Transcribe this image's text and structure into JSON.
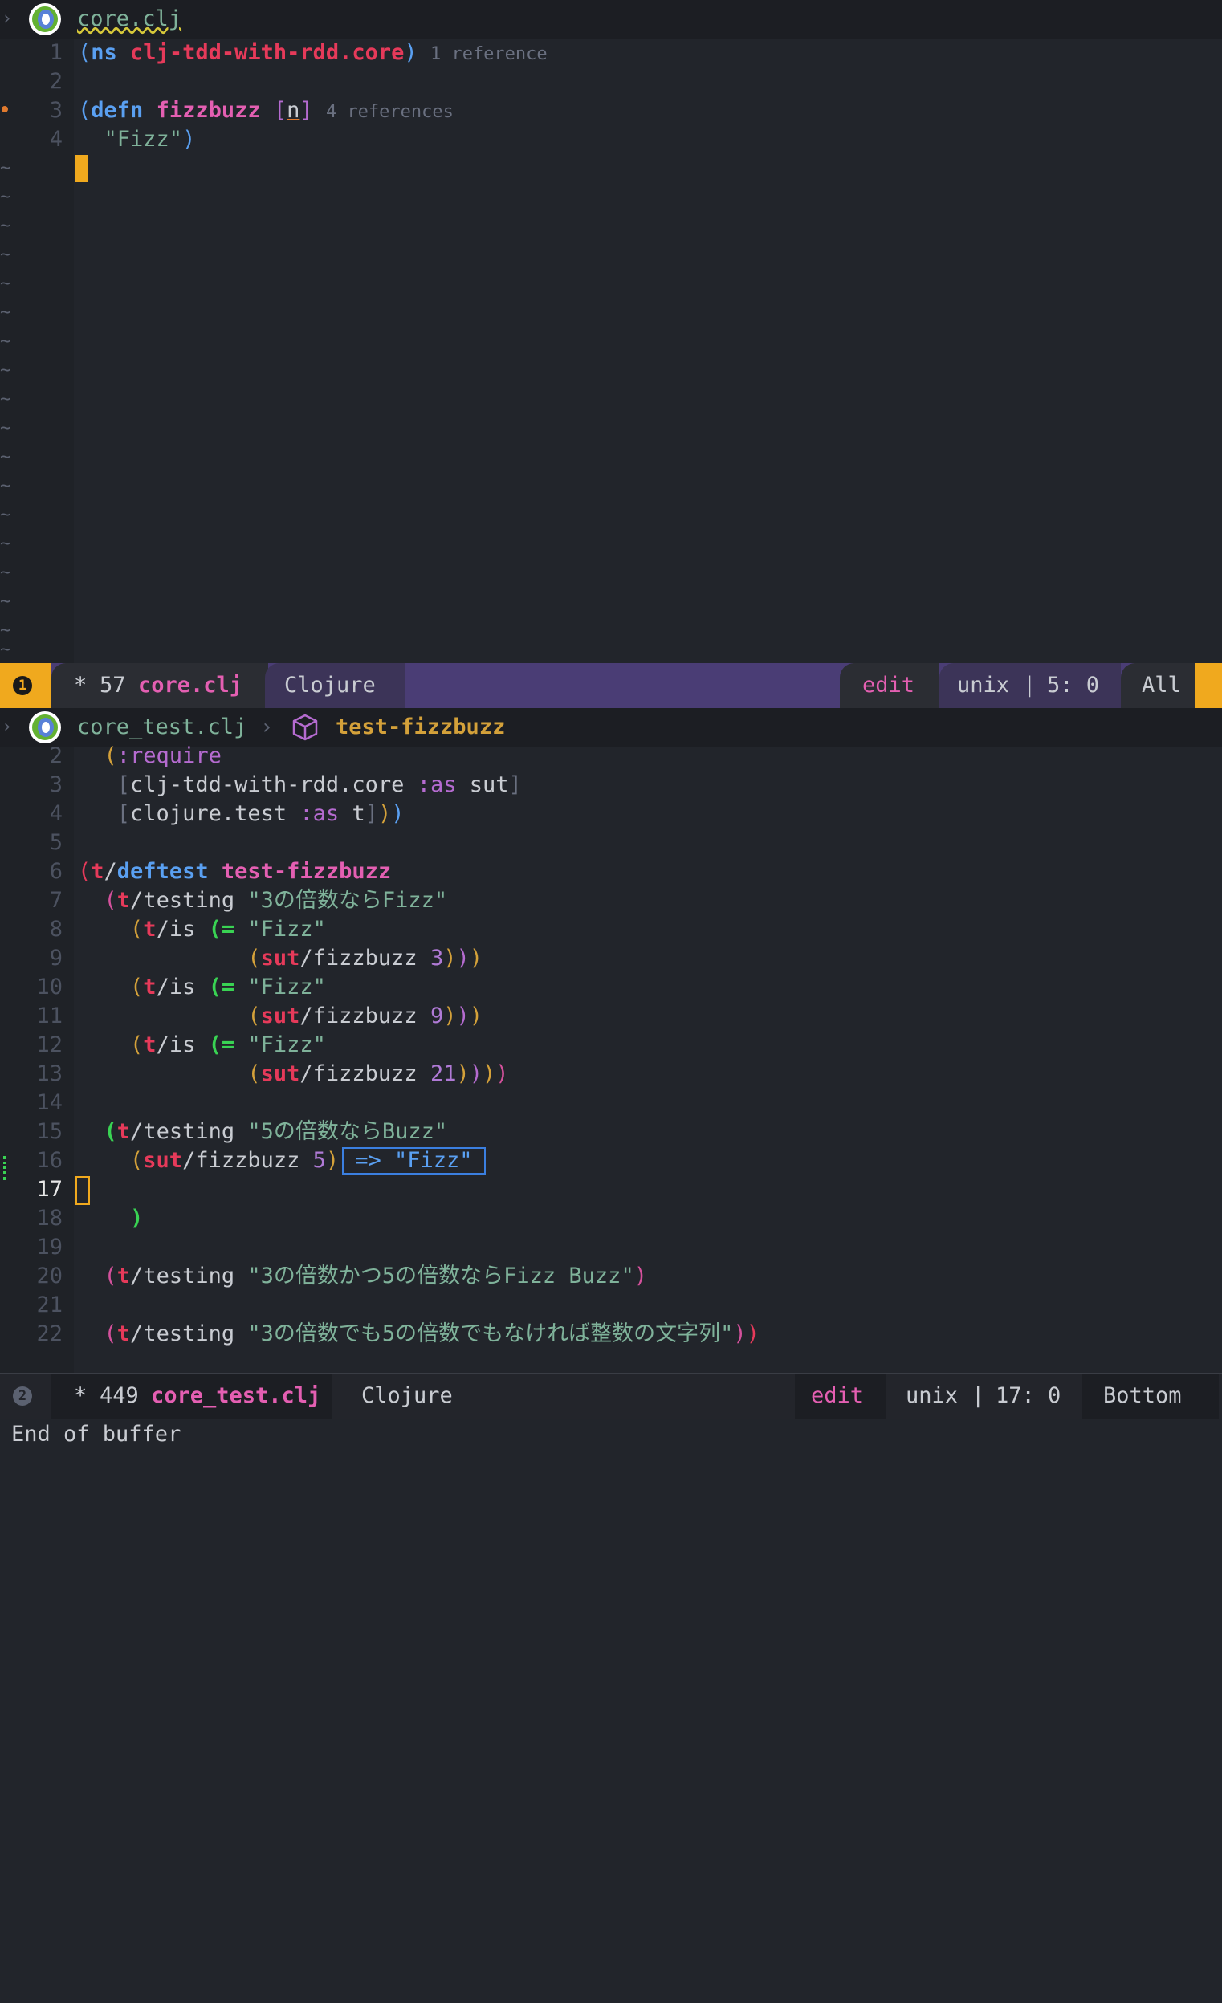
{
  "top": {
    "header": {
      "filename": "core.clj",
      "arrow": "›"
    },
    "lines": [
      {
        "no": "1",
        "ns_kw": "ns",
        "ns_name": "clj-tdd-with-rdd.core",
        "hint": "1 reference"
      },
      {
        "no": "2"
      },
      {
        "no": "3",
        "defn_kw": "defn",
        "fn_name": "fizzbuzz",
        "param": "n",
        "hint": "4 references"
      },
      {
        "no": "4",
        "string": "\"Fizz\""
      }
    ],
    "tilde": "~",
    "modeline": {
      "badge": "1",
      "modified_mark": "*",
      "size": "57",
      "file": "core.clj",
      "major_mode": "Clojure",
      "state": "edit",
      "encoding": "unix",
      "sep": "|",
      "position": "5: 0",
      "scroll": "All"
    }
  },
  "bottom": {
    "header": {
      "filename": "core_test.clj",
      "sep": "›",
      "symbol": "test-fizzbuzz",
      "arrow": "›"
    },
    "line_numbers": [
      "2",
      "3",
      "4",
      "5",
      "6",
      "7",
      "8",
      "9",
      "10",
      "11",
      "12",
      "13",
      "14",
      "15",
      "16",
      "17",
      "18",
      "19",
      "20",
      "21",
      "22"
    ],
    "code": {
      "l2": ":require",
      "l3_ns": "clj-tdd-with-rdd.core",
      "l3_kw": ":as",
      "l3_alias": "sut",
      "l4_ns": "clojure.test",
      "l4_kw": ":as",
      "l4_alias": "t",
      "l6_t": "t",
      "l6_deftest": "deftest",
      "l6_name": "test-fizzbuzz",
      "t": "t",
      "testing": "testing",
      "is": "is",
      "eq": "=",
      "sut": "sut",
      "fizzbuzz": "fizzbuzz",
      "fizz_str": "\"Fizz\"",
      "l7_str": "\"3の倍数ならFizz\"",
      "l9_num": "3",
      "l11_num": "9",
      "l13_num": "21",
      "l15_str": "\"5の倍数ならBuzz\"",
      "l16_num": "5",
      "l16_result": "=> \"Fizz\"",
      "l20_str": "\"3の倍数かつ5の倍数ならFizz Buzz\"",
      "l22_str": "\"3の倍数でも5の倍数でもなければ整数の文字列\""
    },
    "modeline": {
      "badge": "2",
      "modified_mark": "*",
      "size": "449",
      "file": "core_test.clj",
      "major_mode": "Clojure",
      "state": "edit",
      "encoding": "unix",
      "sep": "|",
      "position": "17: 0",
      "scroll": "Bottom"
    }
  },
  "echo_area": "End of buffer",
  "colors": {
    "background": "#22252b",
    "modeline_active": "#4a3d75",
    "accent_orange": "#f0a91e",
    "keyword_blue": "#5aa0f2",
    "function_pink": "#e45fb2",
    "namespace_red": "#e63a5a",
    "string_green": "#7fb29a"
  }
}
